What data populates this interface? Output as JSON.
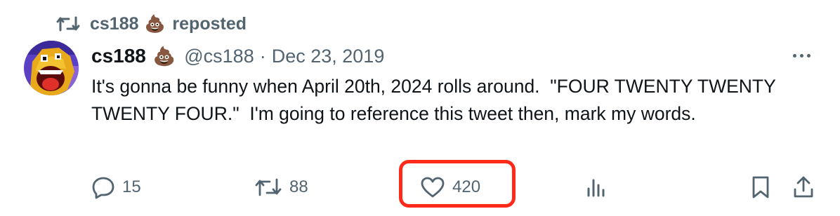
{
  "repost": {
    "user": "cs188",
    "emoji": "💩",
    "label": "reposted"
  },
  "tweet": {
    "display_name": "cs188",
    "emoji": "💩",
    "handle": "@cs188",
    "separator": "·",
    "date": "Dec 23, 2019",
    "text": "It's gonna be funny when April 20th, 2024 rolls around.  \"FOUR TWENTY TWENTY TWENTY FOUR.\"  I'm going to reference this tweet then, mark my words."
  },
  "actions": {
    "replies": "15",
    "reposts": "88",
    "likes": "420"
  },
  "icons": {
    "repost_header": "repost-icon",
    "more": "more-icon",
    "reply": "reply-icon",
    "repost": "repost-icon",
    "like": "heart-icon",
    "views": "analytics-icon",
    "bookmark": "bookmark-icon",
    "share": "share-icon"
  },
  "colors": {
    "secondary_text": "#536471",
    "primary_text": "#0f1419",
    "highlight_border": "#ff2a1a"
  }
}
